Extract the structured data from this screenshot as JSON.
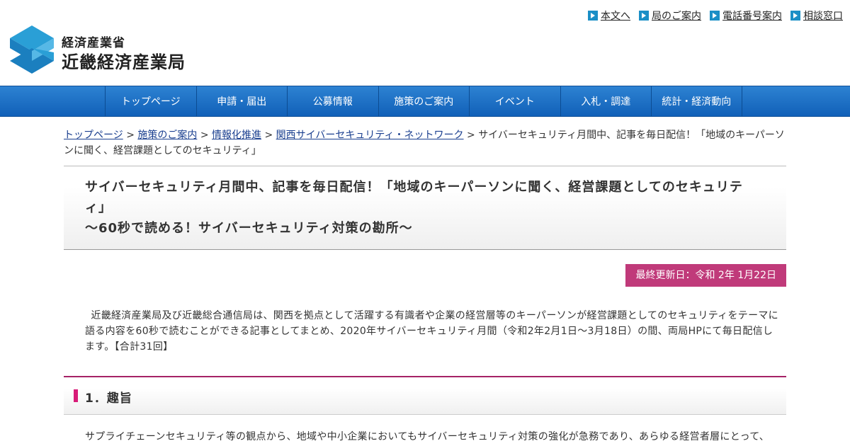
{
  "header": {
    "ministry": "経済産業省",
    "bureau": "近畿経済産業局",
    "util_links": [
      "本文へ",
      "局のご案内",
      "電話番号案内",
      "相談窓口"
    ]
  },
  "gnav": [
    "トップページ",
    "申請・届出",
    "公募情報",
    "施策のご案内",
    "イベント",
    "入札・調達",
    "統計・経済動向"
  ],
  "breadcrumb": {
    "items": [
      "トップページ",
      "施策のご案内",
      "情報化推進",
      "関西サイバーセキュリティ・ネットワーク"
    ],
    "separator": ">",
    "current": "サイバーセキュリティ月間中、記事を毎日配信！「地域のキーパーソンに聞く、経営課題としてのセキュリティ」"
  },
  "title": {
    "line1": "サイバーセキュリティ月間中、記事を毎日配信！「地域のキーパーソンに聞く、経営課題としてのセキュリティ」",
    "line2": "～60秒で読める！サイバーセキュリティ対策の勘所～"
  },
  "updated": "最終更新日：令和 2年 1月22日",
  "intro": "近畿経済産業局及び近畿総合通信局は、関西を拠点として活躍する有識者や企業の経営層等のキーパーソンが経営課題としてのセキュリティをテーマに語る内容を60秒で読むことができる記事としてまとめ、2020年サイバーセキュリティ月間（令和2年2月1日～3月18日）の間、両局HPにて毎日配信します。【合計31回】",
  "section1": {
    "heading": "1．趣旨",
    "text": "サプライチェーンセキュリティ等の観点から、地域や中小企業においてもサイバーセキュリティ対策の強化が急務であり、あらゆる経営者層にとって、"
  },
  "colors": {
    "nav": "#1f70c4",
    "accent": "#c03a7a",
    "section_bar": "#d81b78",
    "util_icon": "#1b8fc6"
  }
}
